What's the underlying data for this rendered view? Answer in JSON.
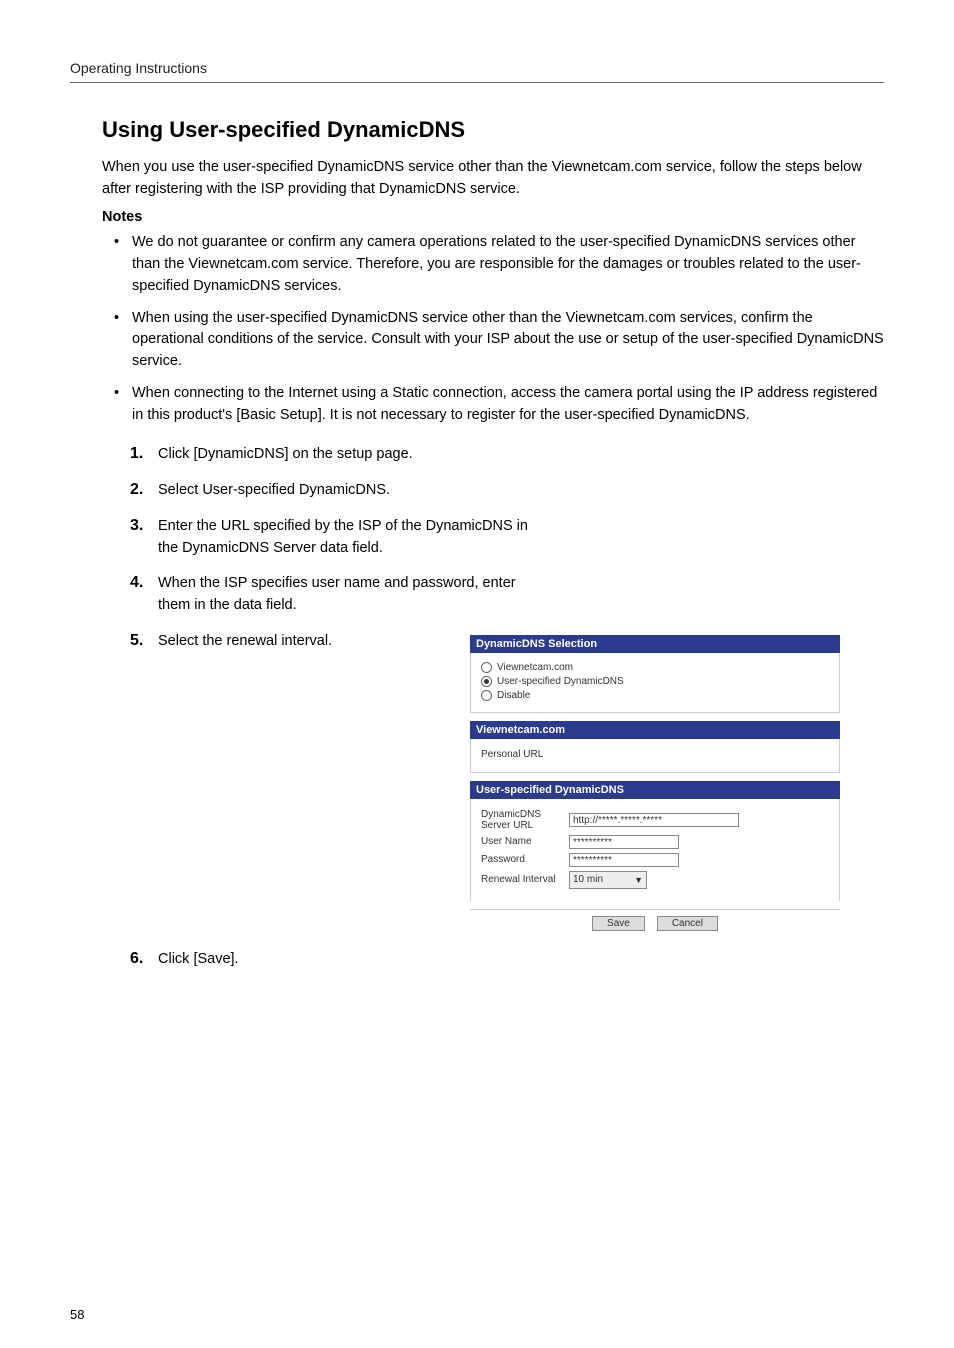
{
  "header": {
    "running": "Operating Instructions"
  },
  "title": "Using User-specified DynamicDNS",
  "intro": "When you use the user-specified DynamicDNS service other than the Viewnetcam.com service, follow the steps below after registering with the ISP providing that DynamicDNS service.",
  "notesLabel": "Notes",
  "notes": [
    "We do not guarantee or confirm any camera operations related to the user-specified DynamicDNS services other than the Viewnetcam.com service. Therefore, you are responsible for the damages or troubles related to the user-specified DynamicDNS services.",
    "When using the user-specified DynamicDNS service other than the Viewnetcam.com services, confirm the operational conditions of the service. Consult with your ISP about the use or setup of the user-specified DynamicDNS service.",
    "When connecting to the Internet using a Static connection, access the camera portal using the IP address registered in this product's [Basic Setup]. It is not necessary to register for the user-specified DynamicDNS."
  ],
  "steps": [
    "Click [DynamicDNS] on the setup page.",
    "Select User-specified DynamicDNS.",
    "Enter the URL specified by the ISP of the DynamicDNS in the DynamicDNS Server data field.",
    "When the ISP specifies user name and password, enter them in the data field.",
    "Select the renewal interval."
  ],
  "step6": "Click [Save].",
  "panel": {
    "selectionHeader": "DynamicDNS Selection",
    "optViewnetcam": "Viewnetcam.com",
    "optUserSpec": "User-specified DynamicDNS",
    "optDisable": "Disable",
    "viewnetHeader": "Viewnetcam.com",
    "personalUrlLabel": "Personal URL",
    "userSpecHeader": "User-specified DynamicDNS",
    "serverUrlLabel": "DynamicDNS Server URL",
    "serverUrlValue": "http://*****.*****.*****",
    "userNameLabel": "User Name",
    "userNameValue": "**********",
    "passwordLabel": "Password",
    "passwordValue": "**********",
    "renewalLabel": "Renewal Interval",
    "renewalValue": "10 min",
    "saveBtn": "Save",
    "cancelBtn": "Cancel"
  },
  "pageNumber": "58"
}
